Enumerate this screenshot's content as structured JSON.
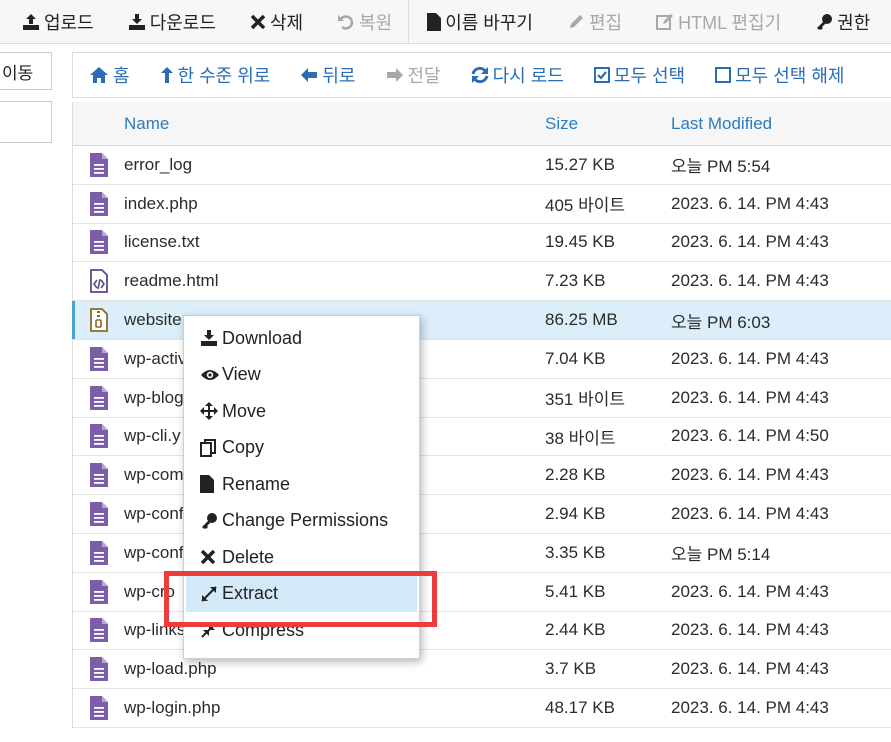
{
  "toolbar": {
    "buttons": [
      {
        "label": "업로드",
        "icon": "upload-icon",
        "enabled": true
      },
      {
        "label": "다운로드",
        "icon": "download-icon",
        "enabled": true
      },
      {
        "label": "삭제",
        "icon": "close-icon",
        "enabled": true
      },
      {
        "label": "복원",
        "icon": "undo-icon",
        "enabled": false
      },
      {
        "label": "이름 바꾸기",
        "icon": "file-icon",
        "enabled": true
      },
      {
        "label": "편집",
        "icon": "pencil-icon",
        "enabled": false
      },
      {
        "label": "HTML 편집기",
        "icon": "html-edit-icon",
        "enabled": false
      },
      {
        "label": "권한",
        "icon": "key-icon",
        "enabled": true
      }
    ]
  },
  "left_panel": {
    "go_label": "이동"
  },
  "nav": {
    "items": [
      {
        "label": "홈",
        "icon": "home-icon",
        "enabled": true
      },
      {
        "label": "한 수준 위로",
        "icon": "level-up-icon",
        "enabled": true
      },
      {
        "label": "뒤로",
        "icon": "arrow-left-icon",
        "enabled": true
      },
      {
        "label": "전달",
        "icon": "arrow-right-icon",
        "enabled": false
      },
      {
        "label": "다시 로드",
        "icon": "reload-icon",
        "enabled": true
      },
      {
        "label": "모두 선택",
        "icon": "checkbox-checked-icon",
        "enabled": true
      },
      {
        "label": "모두 선택 해제",
        "icon": "checkbox-empty-icon",
        "enabled": true
      }
    ]
  },
  "table": {
    "headers": {
      "name": "Name",
      "size": "Size",
      "modified": "Last Modified"
    },
    "rows": [
      {
        "name": "error_log",
        "size": "15.27 KB",
        "modified": "오늘 PM 5:54",
        "icon": "file-text-icon"
      },
      {
        "name": "index.php",
        "size": "405 바이트",
        "modified": "2023. 6. 14. PM 4:43",
        "icon": "file-text-icon"
      },
      {
        "name": "license.txt",
        "size": "19.45 KB",
        "modified": "2023. 6. 14. PM 4:43",
        "icon": "file-text-icon"
      },
      {
        "name": "readme.html",
        "size": "7.23 KB",
        "modified": "2023. 6. 14. PM 4:43",
        "icon": "file-code-icon"
      },
      {
        "name": "website",
        "size": "86.25 MB",
        "modified": "오늘 PM 6:03",
        "icon": "file-archive-icon",
        "selected": true
      },
      {
        "name": "wp-activ",
        "size": "7.04 KB",
        "modified": "2023. 6. 14. PM 4:43",
        "icon": "file-text-icon"
      },
      {
        "name": "wp-blog",
        "size": "351 바이트",
        "modified": "2023. 6. 14. PM 4:43",
        "icon": "file-text-icon"
      },
      {
        "name": "wp-cli.y",
        "size": "38 바이트",
        "modified": "2023. 6. 14. PM 4:50",
        "icon": "file-text-icon"
      },
      {
        "name": "wp-com",
        "size": "2.28 KB",
        "modified": "2023. 6. 14. PM 4:43",
        "icon": "file-text-icon"
      },
      {
        "name": "wp-conf",
        "size": "2.94 KB",
        "modified": "2023. 6. 14. PM 4:43",
        "icon": "file-text-icon"
      },
      {
        "name": "wp-conf",
        "size": "3.35 KB",
        "modified": "오늘 PM 5:14",
        "icon": "file-text-icon"
      },
      {
        "name": "wp-cro",
        "size": "5.41 KB",
        "modified": "2023. 6. 14. PM 4:43",
        "icon": "file-text-icon"
      },
      {
        "name": "wp-links",
        "size": "2.44 KB",
        "modified": "2023. 6. 14. PM 4:43",
        "icon": "file-text-icon"
      },
      {
        "name": "wp-load.php",
        "size": "3.7 KB",
        "modified": "2023. 6. 14. PM 4:43",
        "icon": "file-text-icon"
      },
      {
        "name": "wp-login.php",
        "size": "48.17 KB",
        "modified": "2023. 6. 14. PM 4:43",
        "icon": "file-text-icon"
      }
    ]
  },
  "context_menu": {
    "items": [
      {
        "label": "Download",
        "icon": "download-icon"
      },
      {
        "label": "View",
        "icon": "eye-icon"
      },
      {
        "label": "Move",
        "icon": "move-icon"
      },
      {
        "label": "Copy",
        "icon": "copy-icon"
      },
      {
        "label": "Rename",
        "icon": "file-icon"
      },
      {
        "label": "Change Permissions",
        "icon": "key-icon"
      },
      {
        "label": "Delete",
        "icon": "close-icon"
      },
      {
        "label": "Extract",
        "icon": "expand-icon",
        "hovered": true
      },
      {
        "label": "Compress",
        "icon": "compress-icon"
      }
    ]
  },
  "colors": {
    "link_blue": "#2a6db5",
    "file_icon_purple": "#7b5ea7",
    "selected_row": "#dbeefa",
    "highlight_red": "#ee3b3b"
  }
}
